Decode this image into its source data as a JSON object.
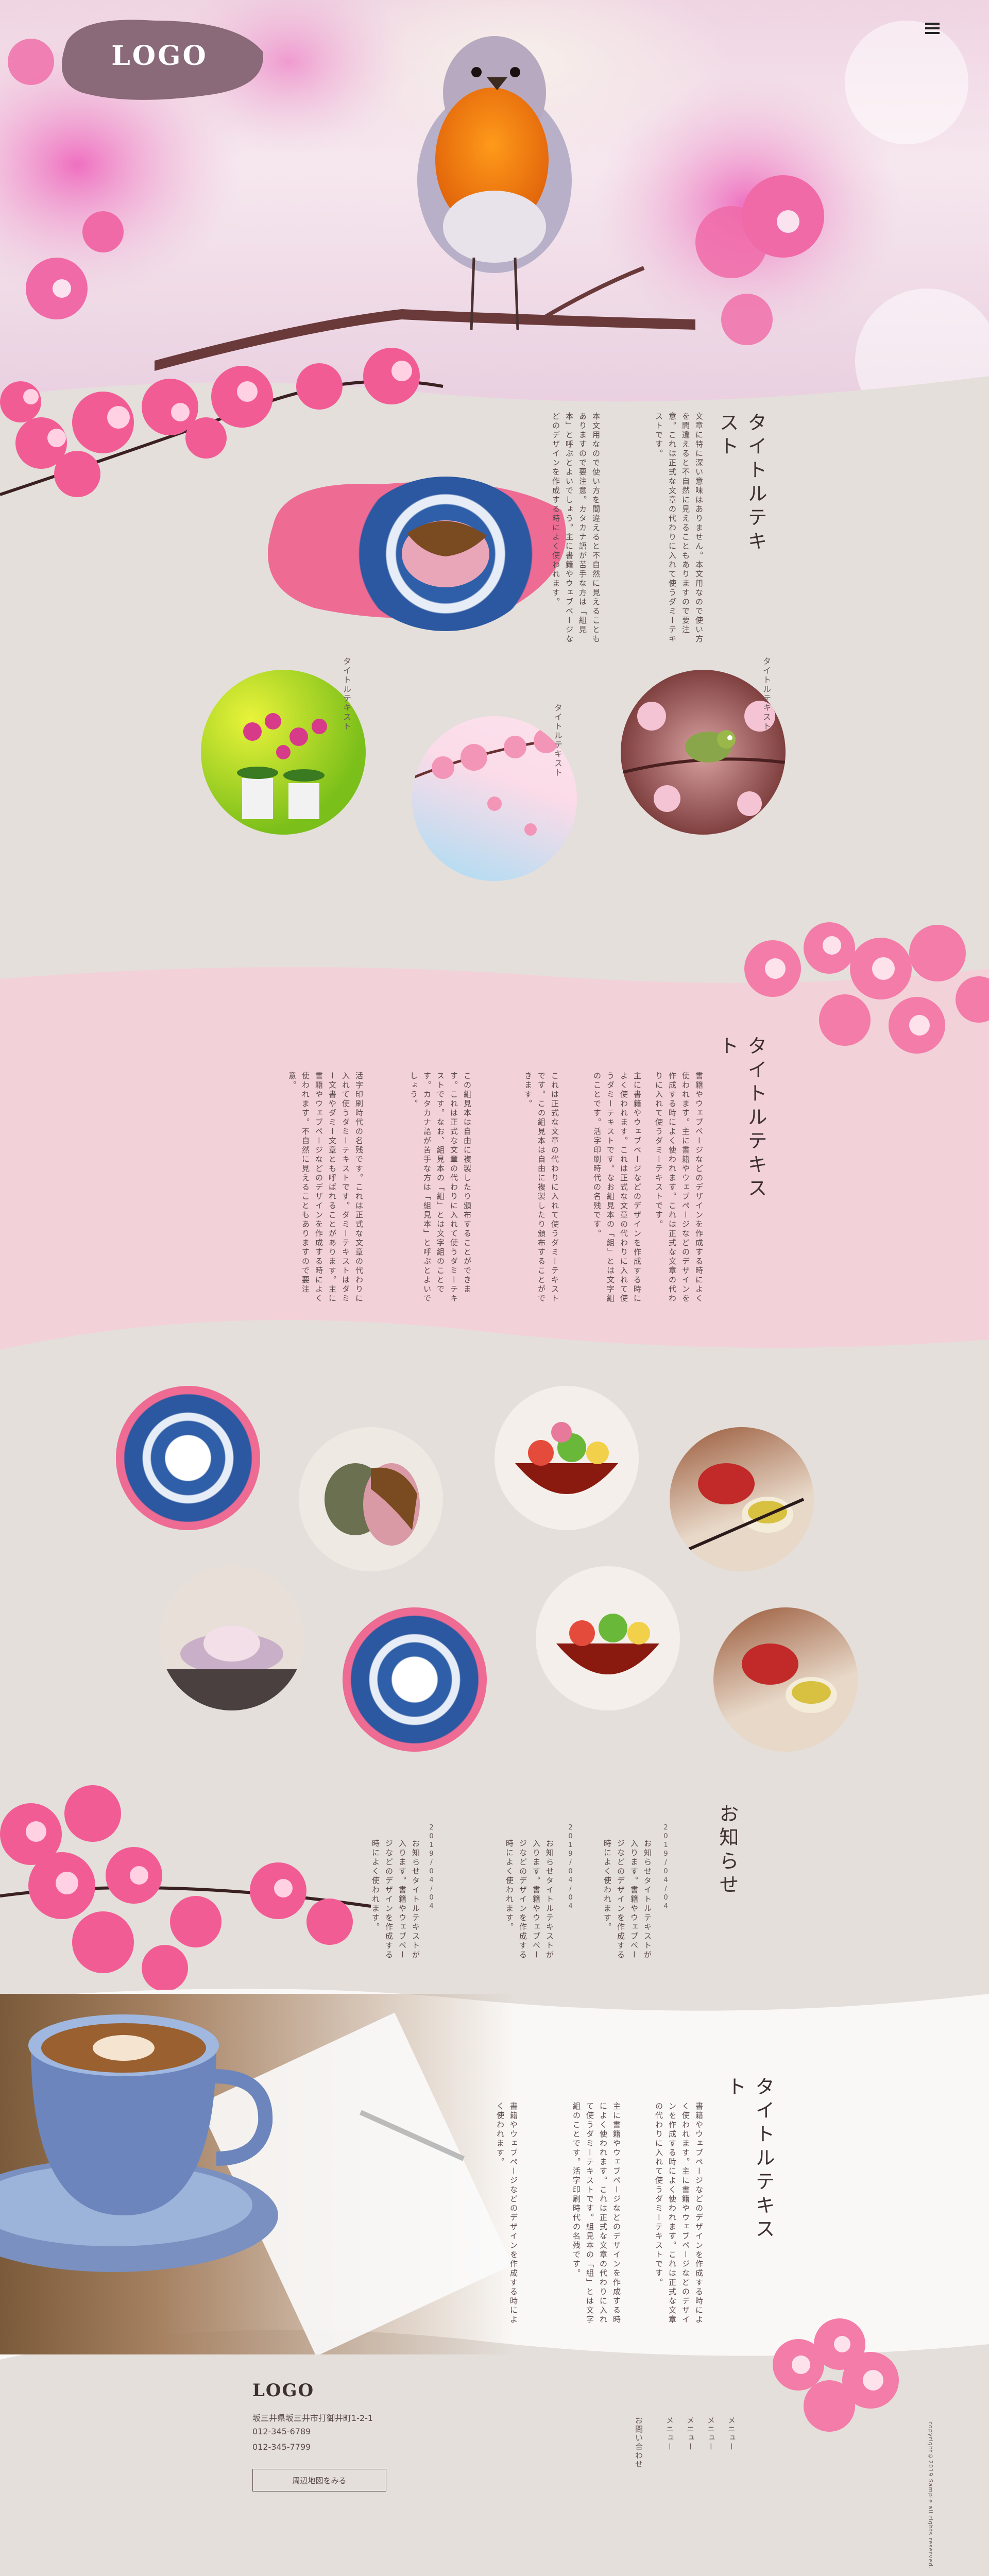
{
  "header": {
    "logo": "LOGO",
    "menu_icon": "hamburger-menu-icon"
  },
  "section1": {
    "title": "タイトルテキスト",
    "text_col1": "文章に特に深い意味はありません。本文用なので使い方を間違えると不自然に見えることもありますので要注意。これは正式な文章の代わりに入れて使うダミーテキストです。",
    "text_col2": "本文用なので使い方を間違えると不自然に見えることもありますので要注意。カタカナ語が苦手な方は「組見本」と呼ぶとよいでしょう。主に書籍やウェブページなどのデザインを作成する時によく使われます。",
    "small_titles": [
      "タイトルテキスト",
      "タイトルテキスト",
      "タイトルテキスト"
    ]
  },
  "section2": {
    "title": "タイトルテキスト",
    "text_cols": [
      "書籍やウェブページなどのデザインを作成する時によく使われます。主に書籍やウェブページなどのデザインを作成する時によく使われます。これは正式な文章の代わりに入れて使うダミーテキストです。",
      "主に書籍やウェブページなどのデザインを作成する時によく使われます。これは正式な文章の代わりに入れて使うダミーテキストです。なお組見本の「組」とは文字組のことです。活字印刷時代の名残です。",
      "これは正式な文章の代わりに入れて使うダミーテキストです。この組見本は自由に複製したり頒布することができます。",
      "この組見本は自由に複製したり頒布することができます。これは正式な文章の代わりに入れて使うダミーテキストです。なお、組見本の「組」とは文字組のことです。カタカナ語が苦手な方は「組見本」と呼ぶとよいでしょう。",
      "活字印刷時代の名残です。これは正式な文章の代わりに入れて使うダミーテキストです。ダミーテキストはダミー文書やダミー文章とも呼ばれることがあります。主に書籍やウェブページなどのデザインを作成する時によく使われます。不自然に見えることもありますので要注意。"
    ]
  },
  "news": {
    "title": "お知らせ",
    "items": [
      {
        "date": "2019/04/04",
        "text": "お知らせタイトルテキストが入ります。書籍やウェブページなどのデザインを作成する時によく使われます。"
      },
      {
        "date": "2019/04/04",
        "text": "お知らせタイトルテキストが入ります。書籍やウェブページなどのデザインを作成する時によく使われます。"
      },
      {
        "date": "2019/04/04",
        "text": "お知らせタイトルテキストが入ります。書籍やウェブページなどのデザインを作成する時によく使われます。"
      }
    ]
  },
  "section3": {
    "title": "タイトルテキスト",
    "text_cols": [
      "書籍やウェブページなどのデザインを作成する時によく使われます。主に書籍やウェブページなどのデザインを作成する時によく使われます。これは正式な文章の代わりに入れて使うダミーテキストです。",
      "主に書籍やウェブページなどのデザインを作成する時によく使われます。これは正式な文章の代わりに入れて使うダミーテキストです。組見本の「組」とは文字組のことです。活字印刷時代の名残です。",
      "書籍やウェブページなどのデザインを作成する時によく使われます。"
    ]
  },
  "footer": {
    "logo": "LOGO",
    "address": "坂三井県坂三井市打御井町1-2-1",
    "tel": "012-345-6789",
    "fax": "012-345-7799",
    "map_button": "周辺地図をみる",
    "menu": [
      "メニュー",
      "メニュー",
      "メニュー",
      "メニュー",
      "お問い合わせ"
    ],
    "copyright": "copyright©2019 Sample all rights reserved."
  },
  "colors": {
    "bg": "#e4dfdb",
    "pink_band": "#f3d1d9",
    "logo_bg": "#8a6a78",
    "white_band": "#faf8f6"
  }
}
